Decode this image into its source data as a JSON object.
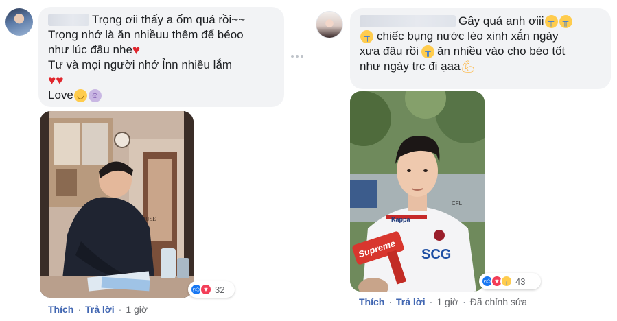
{
  "comments": [
    {
      "author_name": "",
      "lines": [
        {
          "text": "Trọng ơii thấy a ốm quá rồi~~"
        },
        {
          "text": "Trọng nhớ là ăn nhiềuu thêm để béoo"
        },
        {
          "text": "như lúc đầu nhe",
          "trailing": "heart"
        },
        {
          "text": "Tư và mọi người nhớ Ỉnn nhiều lắm"
        },
        {
          "text": "",
          "hearts": 2
        },
        {
          "text": "Love"
        }
      ],
      "reactions": {
        "icons": [
          "like-icon",
          "love-icon"
        ],
        "count": "32"
      },
      "actions": {
        "like": "Thích",
        "reply": "Trả lời",
        "time": "1 giờ"
      }
    },
    {
      "author_name": "",
      "lines": [
        {
          "text": "Gầy quá anh ơiii"
        },
        {
          "text": "chiếc bụng nước lèo xinh xắn ngày"
        },
        {
          "text": "xưa đâu rồi",
          "after": "ăn nhiều vào cho béo tốt"
        },
        {
          "text": "như ngày trc đi ạaa"
        }
      ],
      "reactions": {
        "icons": [
          "like-icon",
          "sad-icon"
        ],
        "count": "43"
      },
      "actions": {
        "like": "Thích",
        "reply": "Trả lời",
        "time": "1 giờ",
        "edited": "Đã chỉnh sửa"
      }
    }
  ],
  "photo_right": {
    "shirt_brand": "SCG",
    "shirt_sponsor": "Kappa",
    "mic_label": "Supreme",
    "sleeve": "CFL"
  },
  "photo_left": {
    "wall_sign": "IN.HOUSE"
  },
  "colors": {
    "bubble": "#f2f3f5",
    "link": "#4267b2",
    "meta": "#65676b",
    "like": "#1877f2",
    "love": "#f33e58"
  }
}
